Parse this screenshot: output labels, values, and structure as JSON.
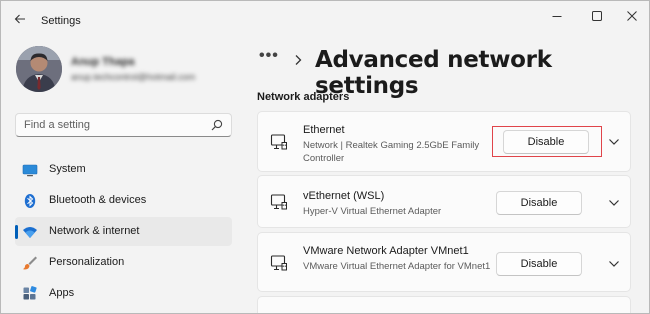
{
  "window": {
    "app_title": "Settings"
  },
  "profile": {
    "name": "Anup Thapa",
    "email": "anup.techcontrol@hotmail.com"
  },
  "search": {
    "placeholder": "Find a setting"
  },
  "sidebar": {
    "items": [
      {
        "label": "System",
        "icon": "system-monitor-icon",
        "active": false
      },
      {
        "label": "Bluetooth & devices",
        "icon": "bluetooth-icon",
        "active": false
      },
      {
        "label": "Network & internet",
        "icon": "wifi-icon",
        "active": true
      },
      {
        "label": "Personalization",
        "icon": "paint-brush-icon",
        "active": false
      },
      {
        "label": "Apps",
        "icon": "apps-icon",
        "active": false
      }
    ]
  },
  "header": {
    "breadcrumb_overflow": "•••",
    "title": "Advanced network settings"
  },
  "main": {
    "section_title": "Network adapters",
    "adapters": [
      {
        "name": "Ethernet",
        "description": "Network | Realtek Gaming 2.5GbE Family Controller",
        "button_label": "Disable",
        "highlighted": true
      },
      {
        "name": "vEthernet (WSL)",
        "description": "Hyper-V Virtual Ethernet Adapter",
        "button_label": "Disable",
        "highlighted": false
      },
      {
        "name": "VMware Network Adapter VMnet1",
        "description": "VMware Virtual Ethernet Adapter for VMnet1",
        "button_label": "Disable",
        "highlighted": false
      }
    ]
  },
  "colors": {
    "accent": "#005fb8",
    "highlight_box": "#e0444a",
    "background": "#f3f3f3"
  }
}
